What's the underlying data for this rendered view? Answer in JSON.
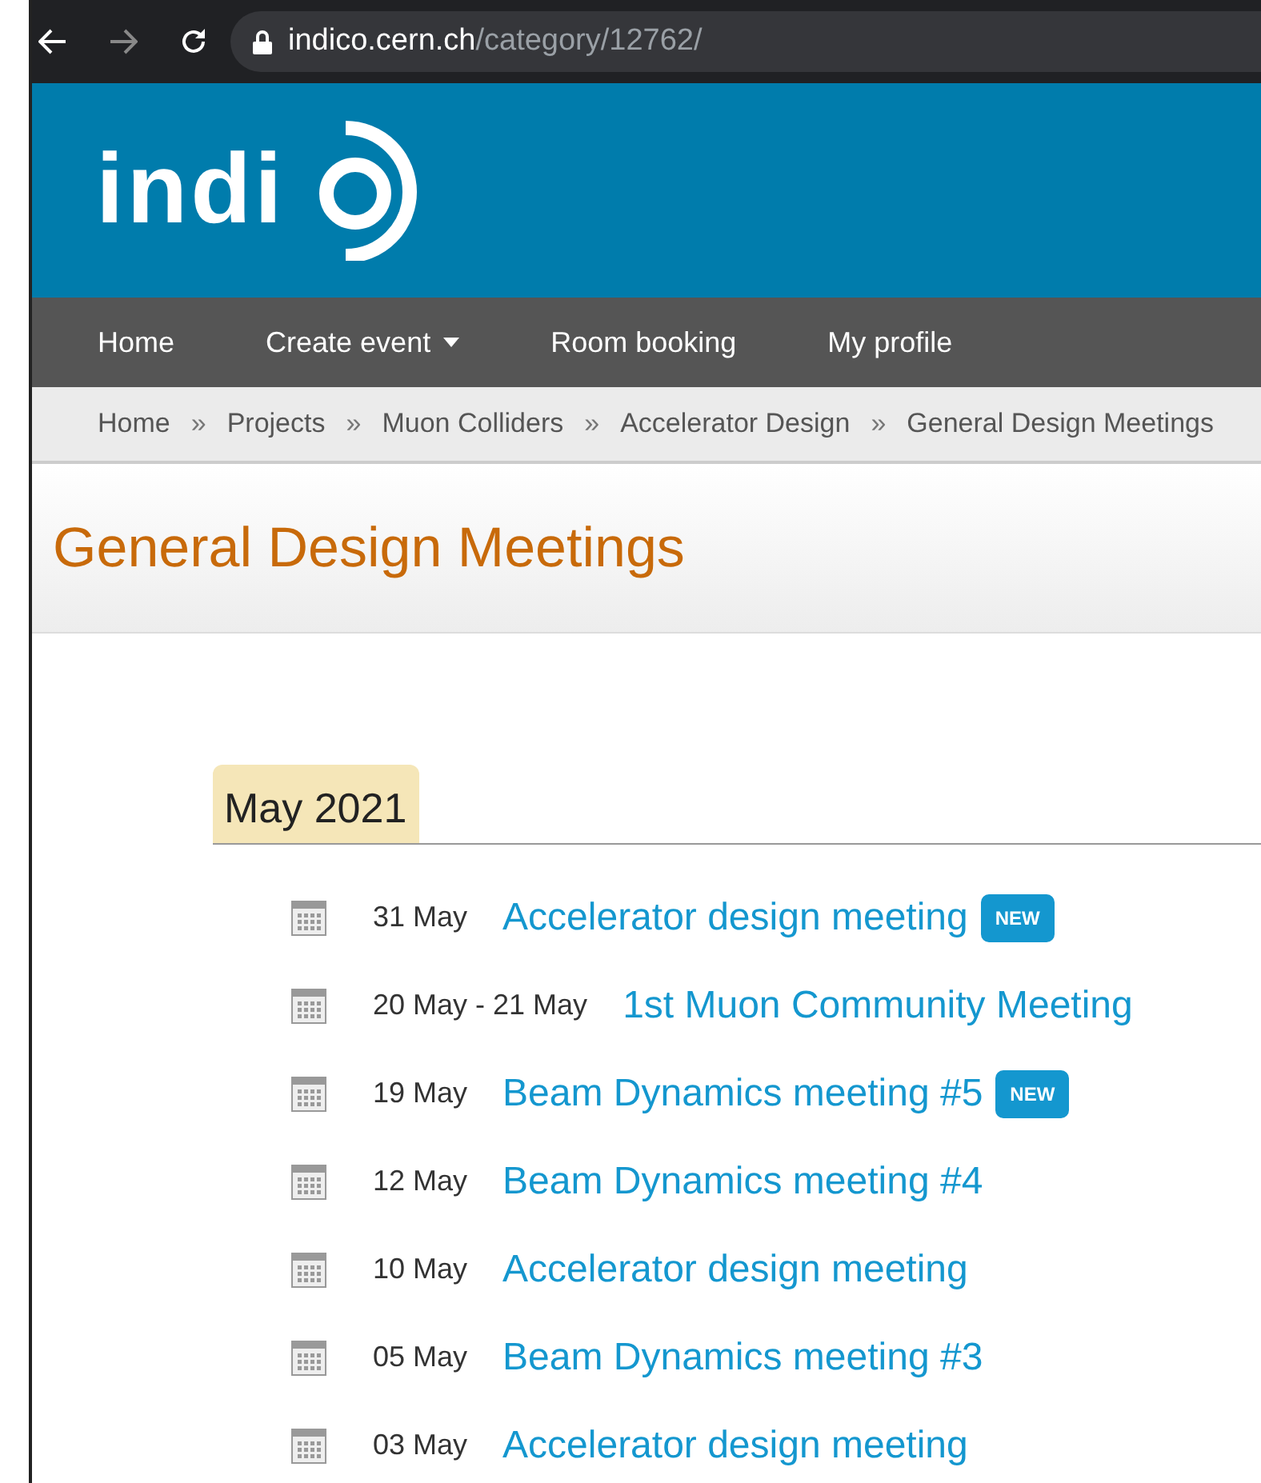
{
  "browser": {
    "url_host": "indico.cern.ch",
    "url_path": "/category/12762/"
  },
  "logo": {
    "text": "indi"
  },
  "nav": [
    {
      "label": "Home",
      "dropdown": false
    },
    {
      "label": "Create event",
      "dropdown": true
    },
    {
      "label": "Room booking",
      "dropdown": false
    },
    {
      "label": "My profile",
      "dropdown": false
    }
  ],
  "breadcrumb": [
    {
      "label": "Home",
      "separator": "»"
    },
    {
      "label": "Projects",
      "separator": "»"
    },
    {
      "label": "Muon Colliders",
      "separator": "»"
    },
    {
      "label": "Accelerator Design",
      "separator": "»"
    },
    {
      "label": "General Design Meetings"
    }
  ],
  "title": "General Design Meetings",
  "month": "May 2021",
  "events": [
    {
      "date": "31 May",
      "title": "Accelerator design meeting",
      "badge": "NEW"
    },
    {
      "date": "20 May - 21 May",
      "title": "1st Muon Community Meeting"
    },
    {
      "date": "19 May",
      "title": "Beam Dynamics meeting #5",
      "badge": "NEW"
    },
    {
      "date": "12 May",
      "title": "Beam Dynamics meeting #4"
    },
    {
      "date": "10 May",
      "title": "Accelerator design meeting"
    },
    {
      "date": "05 May",
      "title": "Beam Dynamics meeting #3"
    },
    {
      "date": "03 May",
      "title": "Accelerator design meeting"
    }
  ]
}
